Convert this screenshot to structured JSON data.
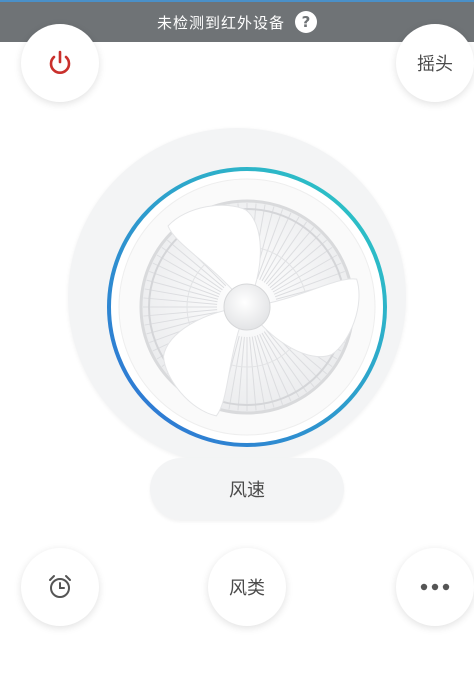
{
  "status_bar": {
    "message": "未检测到红外设备",
    "help_glyph": "?"
  },
  "buttons": {
    "power": {
      "icon": "power-icon",
      "color": "#c9302c"
    },
    "swing": {
      "label": "摇头"
    },
    "timer": {
      "icon": "alarm-clock-icon"
    },
    "mode": {
      "label": "风类"
    },
    "more": {
      "icon": "more-dots-icon",
      "glyph": "•••"
    }
  },
  "fan": {
    "speed_label": "风速",
    "ring_colors": [
      "#2f6fd6",
      "#2ccbc4"
    ]
  }
}
